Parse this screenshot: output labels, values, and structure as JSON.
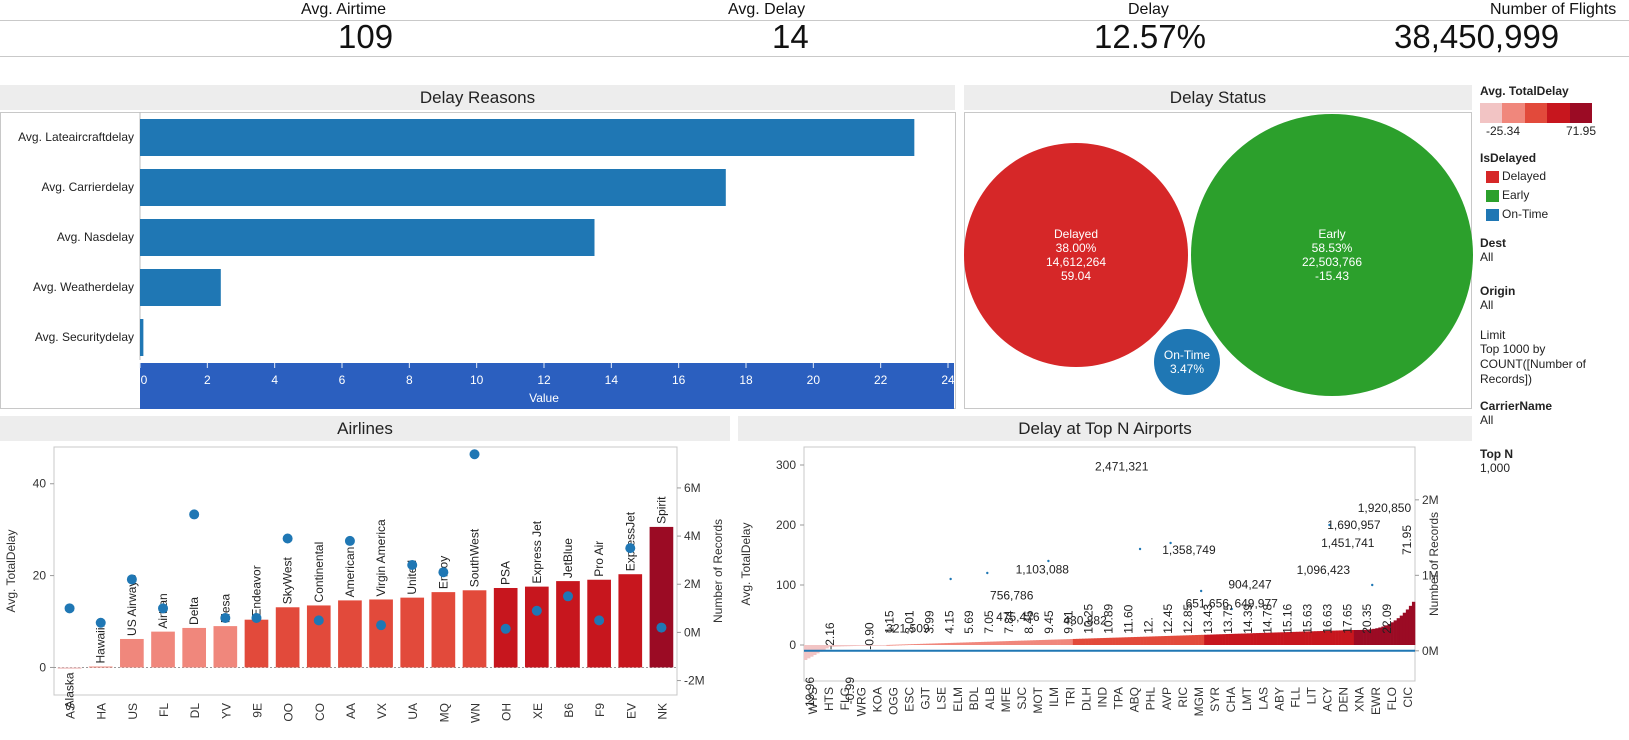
{
  "kpis": [
    {
      "label": "Avg. Airtime",
      "value": "109"
    },
    {
      "label": "Avg. Delay",
      "value": "14"
    },
    {
      "label": "Delay",
      "value": "12.57%"
    },
    {
      "label": "Number of Flights",
      "value": "38,450,999"
    }
  ],
  "colors": {
    "bar_blue": "#1f77b4",
    "axis_band": "#2b5fbf",
    "delayed": "#d62728",
    "early": "#2ca02c",
    "ontime": "#1f77b4",
    "dot": "#1f77b4",
    "gradient": [
      "#f2c4c4",
      "#f0877c",
      "#e24a3b",
      "#c7161e",
      "#9b0b24"
    ]
  },
  "delay_reasons": {
    "title": "Delay Reasons",
    "chart_data": {
      "type": "bar",
      "orientation": "horizontal",
      "categories": [
        "Avg. Lateaircraftdelay",
        "Avg. Carrierdelay",
        "Avg. Nasdelay",
        "Avg. Weatherdelay",
        "Avg. Securitydelay"
      ],
      "values": [
        23.0,
        17.4,
        13.5,
        2.4,
        0.1
      ],
      "xlabel": "Value",
      "xlim": [
        0,
        24
      ],
      "xticks": [
        0,
        2,
        4,
        6,
        8,
        10,
        12,
        14,
        16,
        18,
        20,
        22,
        24
      ]
    }
  },
  "delay_status": {
    "title": "Delay Status",
    "chart_data": {
      "type": "bubble",
      "items": [
        {
          "name": "Delayed",
          "lines": [
            "Delayed",
            "38.00%",
            "14,612,264",
            "59.04"
          ],
          "count": 14612264,
          "share": 38.0,
          "avg_delay": 59.04
        },
        {
          "name": "Early",
          "lines": [
            "Early",
            "58.53%",
            "22,503,766",
            "-15.43"
          ],
          "count": 22503766,
          "share": 58.53,
          "avg_delay": -15.43
        },
        {
          "name": "On-Time",
          "lines": [
            "On-Time",
            "3.47%"
          ],
          "share": 3.47
        }
      ]
    }
  },
  "legend": {
    "gradient_title": "Avg. TotalDelay",
    "gradient_min": "-25.34",
    "gradient_max": "71.95",
    "isdelayed_title": "IsDelayed",
    "isdelayed_items": [
      {
        "label": "Delayed",
        "color": "#d62728"
      },
      {
        "label": "Early",
        "color": "#2ca02c"
      },
      {
        "label": "On-Time",
        "color": "#1f77b4"
      }
    ],
    "filters": [
      {
        "title": "Dest",
        "value": "All"
      },
      {
        "title": "Origin",
        "value": "All"
      },
      {
        "title": "Limit",
        "value": "Top 1000 by COUNT([Number of Records])"
      },
      {
        "title": "CarrierName",
        "value": "All"
      },
      {
        "title": "Top N",
        "value": "1,000"
      }
    ]
  },
  "airlines": {
    "title": "Airlines",
    "chart_data": {
      "type": "bar",
      "categories": [
        "AS",
        "HA",
        "US",
        "FL",
        "DL",
        "YV",
        "9E",
        "OO",
        "CO",
        "AA",
        "VX",
        "UA",
        "MQ",
        "WN",
        "OH",
        "XE",
        "B6",
        "F9",
        "EV",
        "NK"
      ],
      "names": [
        "Alaska",
        "Hawaiin",
        "US Airways",
        "Airtran",
        "Delta",
        "Mesa",
        "Endeavor",
        "SkyWest",
        "Continental",
        "American",
        "Virgin America",
        "United",
        "Envoy",
        "SouthWest",
        "PSA",
        "Express Jet",
        "JetBlue",
        "Pro Air",
        "ExpressJet",
        "Spirit"
      ],
      "series": [
        {
          "name": "Avg. TotalDelay",
          "axis": "left",
          "values": [
            -0.3,
            0.2,
            6.2,
            7.8,
            8.6,
            9.0,
            10.4,
            13.1,
            13.5,
            14.6,
            14.8,
            15.2,
            16.4,
            16.8,
            17.3,
            17.6,
            18.8,
            19.1,
            20.3,
            30.6
          ]
        },
        {
          "name": "Number of Records",
          "axis": "right",
          "values": [
            1000000,
            400000,
            2200000,
            1000000,
            4900000,
            600000,
            600000,
            3900000,
            500000,
            3800000,
            300000,
            2800000,
            2500000,
            7400000,
            150000,
            900000,
            1500000,
            500000,
            3500000,
            200000
          ]
        }
      ],
      "ylabel": "Avg. TotalDelay",
      "ylim": [
        -6,
        48
      ],
      "yticks": [
        0,
        20,
        40
      ],
      "y2label": "Number of Records",
      "y2lim": [
        -2600000,
        7700000
      ],
      "y2ticks_labels": [
        "-2M",
        "0M",
        "2M",
        "4M",
        "6M"
      ],
      "y2ticks": [
        -2000000,
        0,
        2000000,
        4000000,
        6000000
      ]
    }
  },
  "airports": {
    "title": "Delay at Top N Airports",
    "chart_data": {
      "type": "bar",
      "ylabel": "Avg. TotalDelay",
      "y2label": "Number of Records",
      "ylim": [
        -60,
        330
      ],
      "yticks": [
        0,
        100,
        200,
        300
      ],
      "y2lim": [
        -400000,
        2700000
      ],
      "y2ticks_labels": [
        "0M",
        "1M",
        "2M"
      ],
      "y2ticks": [
        0,
        1000000,
        2000000
      ],
      "categories": [
        "WYS",
        "HTS",
        "FLG",
        "WRG",
        "KOA",
        "OGG",
        "ESC",
        "GJT",
        "LSE",
        "ELM",
        "BDL",
        "ALB",
        "MFE",
        "SJC",
        "MOT",
        "ILM",
        "TRI",
        "DLH",
        "IND",
        "TPA",
        "ABQ",
        "PHL",
        "AVP",
        "RIC",
        "MGM",
        "SYR",
        "CHA",
        "LMT",
        "LAS",
        "ABY",
        "FLL",
        "LIT",
        "ACY",
        "DEN",
        "XNA",
        "EWR",
        "FLO",
        "CIC"
      ],
      "bar_labels": [
        "-19.96",
        "-2.16",
        "-0.99",
        "-0.90",
        "1.15",
        "3.01",
        "3.99",
        "4.15",
        "5.69",
        "7.05",
        "7.84",
        "8.45",
        "9.45",
        "9.91",
        "10.25",
        "10.89",
        "11.60",
        "12.",
        "12.45",
        "12.85",
        "13.43",
        "13.75",
        "14.39",
        "14.78",
        "15.16",
        "15.63",
        "16.63",
        "17.65",
        "20.35",
        "22.09",
        "71.95"
      ],
      "count_labels": [
        "2,471,321",
        "1,920,850",
        "1,690,957",
        "1,451,741",
        "1,358,749",
        "1,103,088",
        "1,096,423",
        "904,247",
        "756,786",
        "651,656",
        "649,977",
        "475,476",
        "430,882",
        "321,509"
      ]
    }
  }
}
